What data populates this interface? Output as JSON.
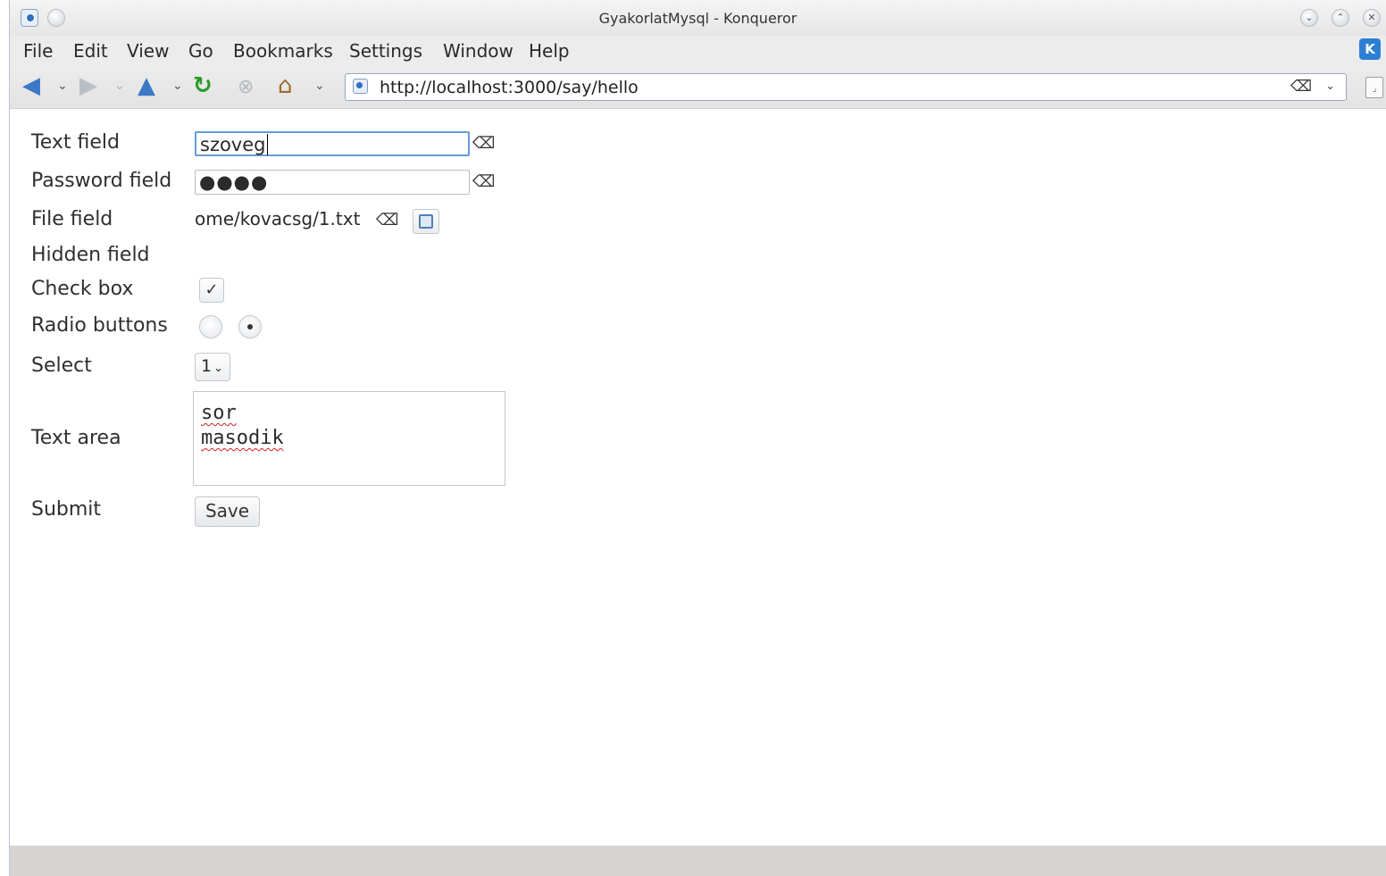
{
  "window": {
    "title": "GyakorlatMysql - Konqueror"
  },
  "menu": [
    "File",
    "Edit",
    "View",
    "Go",
    "Bookmarks",
    "Settings",
    "Window",
    "Help"
  ],
  "toolbar": {
    "url": "http://localhost:3000/say/hello",
    "icons": [
      "back-arrow-icon",
      "forward-arrow-icon",
      "up-arrow-icon",
      "reload-icon",
      "stop-icon",
      "home-icon"
    ]
  },
  "form": {
    "text_label": "Text field",
    "text_value": "szoveg",
    "password_label": "Password field",
    "password_value": "●●●●",
    "file_label": "File field",
    "file_value": "ome/kovacsg/1.txt",
    "hidden_label": "Hidden field",
    "checkbox_label": "Check box",
    "checkbox_mark": "✓",
    "radio_label": "Radio buttons",
    "select_label": "Select",
    "select_value": "1",
    "textarea_label": "Text area",
    "textarea_line1": "sor",
    "textarea_line2": "masodik",
    "submit_label": "Submit",
    "save_label": "Save"
  },
  "colors": {
    "focus_border": "#6a9bd4",
    "reload_green": "#2a9a2a",
    "nav_blue": "#3b78c5"
  }
}
